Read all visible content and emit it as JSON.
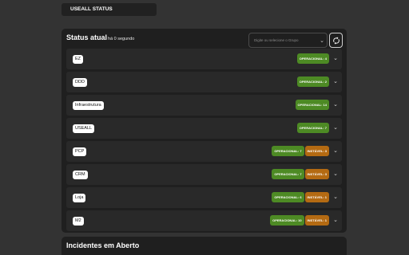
{
  "header": {
    "title": "USEALL STATUS"
  },
  "status": {
    "title": "Status atual",
    "subtitle": "há 0 segundo",
    "select_placeholder": "Digite ou selecione o Grupo",
    "rows": [
      {
        "label": "EZ",
        "badges": [
          {
            "kind": "op",
            "text": "OPERACIONAL: 4"
          }
        ]
      },
      {
        "label": "DDD",
        "badges": [
          {
            "kind": "op",
            "text": "OPERACIONAL: 2"
          }
        ]
      },
      {
        "label": "Infraestrutura",
        "badges": [
          {
            "kind": "op",
            "text": "OPERACIONAL: 14"
          }
        ]
      },
      {
        "label": "USEALL",
        "badges": [
          {
            "kind": "op",
            "text": "OPERACIONAL: 7"
          }
        ]
      },
      {
        "label": "PCP",
        "badges": [
          {
            "kind": "op",
            "text": "OPERACIONAL: 7"
          },
          {
            "kind": "inst",
            "text": "INSTÁVEL: 3"
          }
        ]
      },
      {
        "label": "CRM",
        "badges": [
          {
            "kind": "op",
            "text": "OPERACIONAL: 7"
          },
          {
            "kind": "inst",
            "text": "INSTÁVEL: 3"
          }
        ]
      },
      {
        "label": "Loja",
        "badges": [
          {
            "kind": "op",
            "text": "OPERACIONAL: 6"
          },
          {
            "kind": "inst",
            "text": "INSTÁVEL: 1"
          }
        ]
      },
      {
        "label": "M2",
        "badges": [
          {
            "kind": "op",
            "text": "OPERACIONAL: 10"
          },
          {
            "kind": "inst",
            "text": "INSTÁVEL: 1"
          }
        ]
      }
    ]
  },
  "incidents": {
    "title": "Incidentes em Aberto"
  },
  "colors": {
    "operational": "#4d8a24",
    "unstable": "#b46a12",
    "panel": "#1f1f1f",
    "background": "#333333"
  },
  "icons": {
    "select_chevron": "chevron-down-icon",
    "refresh": "refresh-icon",
    "row_expand": "chevron-down-icon"
  }
}
